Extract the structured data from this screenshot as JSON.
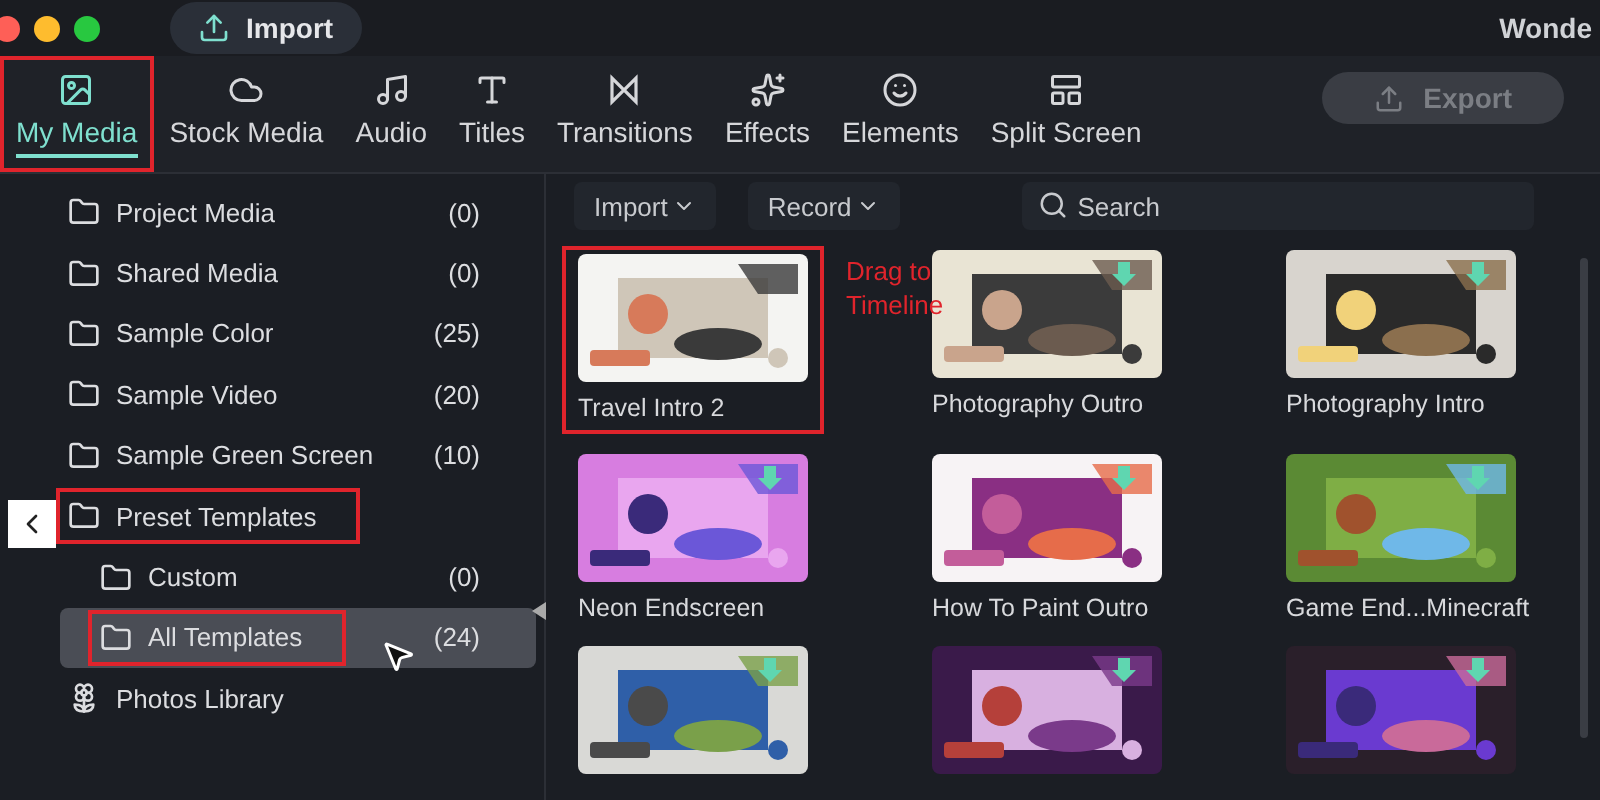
{
  "window": {
    "import_button": "Import",
    "title": "Wonde"
  },
  "tabs": [
    {
      "label": "My Media",
      "selected": true,
      "annotated": true
    },
    {
      "label": "Stock Media",
      "selected": false,
      "annotated": false
    },
    {
      "label": "Audio",
      "selected": false,
      "annotated": false
    },
    {
      "label": "Titles",
      "selected": false,
      "annotated": false
    },
    {
      "label": "Transitions",
      "selected": false,
      "annotated": false
    },
    {
      "label": "Effects",
      "selected": false,
      "annotated": false
    },
    {
      "label": "Elements",
      "selected": false,
      "annotated": false
    },
    {
      "label": "Split Screen",
      "selected": false,
      "annotated": false
    }
  ],
  "export_button": {
    "label": "Export",
    "disabled": true
  },
  "sidebar": {
    "items": [
      {
        "label": "Project Media",
        "count": "(0)",
        "kind": "folder",
        "selected": false,
        "annotated": false
      },
      {
        "label": "Shared Media",
        "count": "(0)",
        "kind": "folder",
        "selected": false,
        "annotated": false
      },
      {
        "label": "Sample Color",
        "count": "(25)",
        "kind": "folder",
        "selected": false,
        "annotated": false
      },
      {
        "label": "Sample Video",
        "count": "(20)",
        "kind": "folder",
        "selected": false,
        "annotated": false
      },
      {
        "label": "Sample Green Screen",
        "count": "(10)",
        "kind": "folder",
        "selected": false,
        "annotated": false
      },
      {
        "label": "Preset Templates",
        "kind": "folder",
        "selected": false,
        "annotated": true,
        "children": [
          {
            "label": "Custom",
            "count": "(0)",
            "kind": "folder",
            "selected": false,
            "annotated": false
          },
          {
            "label": "All Templates",
            "count": "(24)",
            "kind": "folder",
            "selected": true,
            "annotated": true
          }
        ]
      },
      {
        "label": "Photos Library",
        "kind": "photos",
        "selected": false,
        "annotated": false
      }
    ]
  },
  "toolbar": {
    "import": "Import",
    "record": "Record",
    "search": {
      "placeholder": "Search"
    }
  },
  "annotation": {
    "note": "Drag to Timeline"
  },
  "templates": [
    {
      "name": "Travel Intro 2",
      "annotated": true,
      "download": false,
      "kind": "picture"
    },
    {
      "name": "Photography Outro",
      "annotated": false,
      "download": true,
      "kind": "picture"
    },
    {
      "name": "Photography Intro",
      "annotated": false,
      "download": true,
      "kind": "picture"
    },
    {
      "name": "Neon Endscreen",
      "annotated": false,
      "download": true,
      "kind": "picture"
    },
    {
      "name": "How To Paint Outro",
      "annotated": false,
      "download": true,
      "kind": "picture"
    },
    {
      "name": "Game End...Minecraft",
      "annotated": false,
      "download": true,
      "kind": "picture"
    },
    {
      "annotated": false,
      "download": true,
      "kind": "picture"
    },
    {
      "annotated": false,
      "download": true,
      "kind": "picture"
    },
    {
      "annotated": false,
      "download": true,
      "kind": "picture"
    }
  ]
}
